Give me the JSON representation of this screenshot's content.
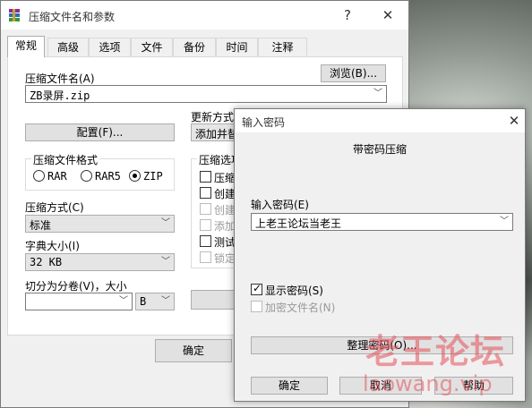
{
  "main_window": {
    "title": "压缩文件名和参数",
    "help": "?",
    "close": "✕",
    "tabs": [
      "常规",
      "高级",
      "选项",
      "文件",
      "备份",
      "时间",
      "注释"
    ],
    "archive_name_label": "压缩文件名(A)",
    "browse_button": "浏览(B)...",
    "archive_name_value": "ZB录屏.zip",
    "update_mode_label": "更新方式",
    "update_mode_value": "添加并替",
    "profiles_button": "配置(F)...",
    "format_group_label": "压缩文件格式",
    "formats": [
      "RAR",
      "RAR5",
      "ZIP"
    ],
    "selected_format": "ZIP",
    "options_group_label": "压缩选项",
    "options": [
      {
        "label": "压缩",
        "checked": false,
        "enabled": true
      },
      {
        "label": "创建",
        "checked": false,
        "enabled": true
      },
      {
        "label": "创建",
        "checked": false,
        "enabled": false
      },
      {
        "label": "添加",
        "checked": false,
        "enabled": false
      },
      {
        "label": "测试",
        "checked": false,
        "enabled": true
      },
      {
        "label": "锁定",
        "checked": false,
        "enabled": false
      }
    ],
    "method_label": "压缩方式(C)",
    "method_value": "标准",
    "dict_label": "字典大小(I)",
    "dict_value": "32 KB",
    "split_label": "切分为分卷(V)，大小",
    "split_value": "",
    "split_unit": "B",
    "ok_button": "确定"
  },
  "password_dialog": {
    "title": "输入密码",
    "close": "✕",
    "header": "带密码压缩",
    "password_label": "输入密码(E)",
    "password_value": "上老王论坛当老王",
    "show_password_label": "显示密码(S)",
    "show_password_checked": true,
    "encrypt_names_label": "加密文件名(N)",
    "encrypt_names_checked": false,
    "organize_button": "整理密码(O)...",
    "ok_button": "确定",
    "cancel_button": "取消",
    "help_button": "帮助"
  },
  "watermark": {
    "text": "老王论坛",
    "url": "laowang.vip"
  },
  "colors": {
    "dialog_bg": "#f0f0f0",
    "button_bg": "#e1e1e1",
    "watermark": "#e6505a"
  }
}
